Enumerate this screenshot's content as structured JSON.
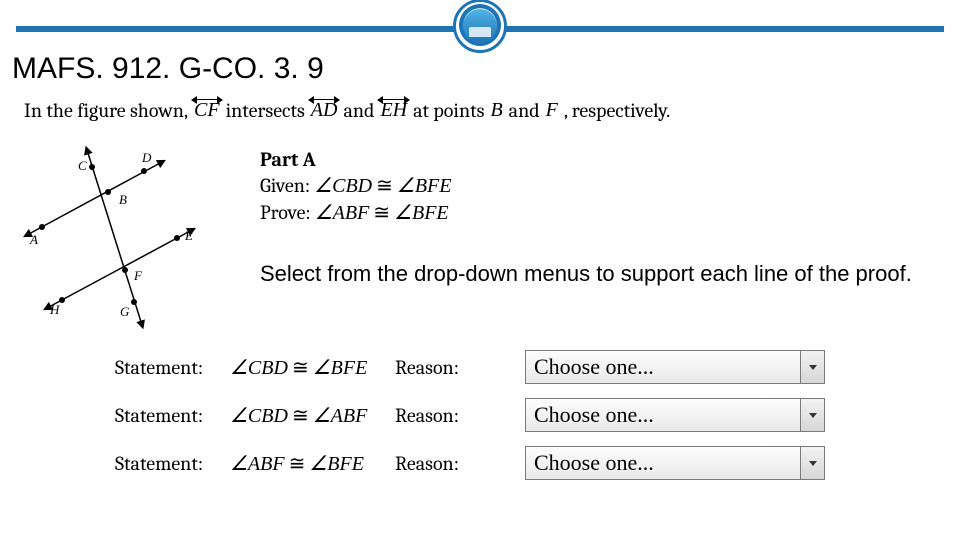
{
  "standard_code": "MAFS. 912. G-CO. 3. 9",
  "stem": {
    "t1": "In the figure shown, ",
    "seg1": "CF",
    "t2": " intersects ",
    "seg2": "AD",
    "t3": " and ",
    "seg3": "EH",
    "t4": " at points ",
    "pt1": "B",
    "t5": " and ",
    "pt2": "F",
    "t6": ", respectively."
  },
  "figure_points": {
    "A": "A",
    "B": "B",
    "C": "C",
    "D": "D",
    "E": "E",
    "F": "F",
    "G": "G",
    "H": "H"
  },
  "part_a": {
    "title": "Part A",
    "given_label": "Given:",
    "given_lhs": "∠CBD",
    "cong": "≅",
    "given_rhs": "∠BFE",
    "prove_label": "Prove:",
    "prove_lhs": "∠ABF",
    "prove_rhs": "∠BFE"
  },
  "instruction": "Select from the drop-down menus to support each line of the proof.",
  "proof": {
    "statement_label": "Statement:",
    "reason_label": "Reason:",
    "rows": [
      {
        "lhs": "∠CBD",
        "rhs": "∠BFE"
      },
      {
        "lhs": "∠CBD",
        "rhs": "∠ABF"
      },
      {
        "lhs": "∠ABF",
        "rhs": "∠BFE"
      }
    ],
    "dropdown_placeholder": "Choose one..."
  },
  "cong_symbol": "≅"
}
